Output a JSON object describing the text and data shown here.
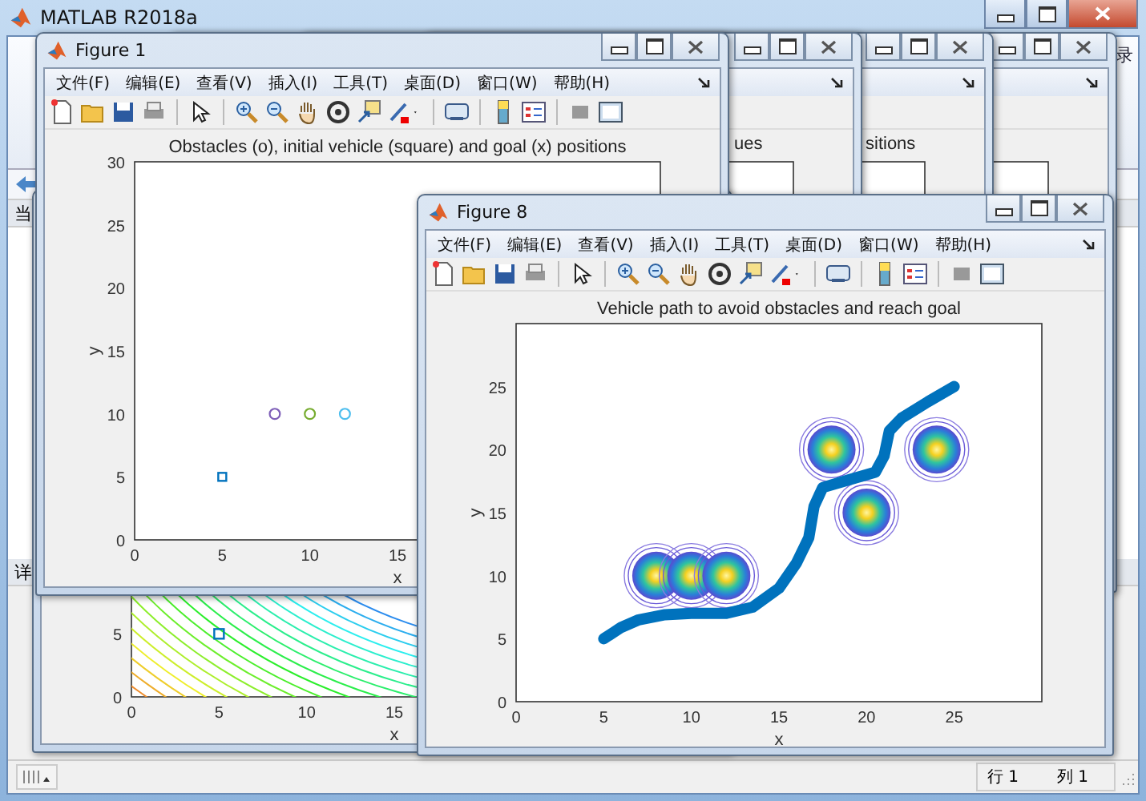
{
  "main_window": {
    "title": "MATLAB R2018a",
    "header_fragment": "录",
    "left_labels": [
      "当",
      "详"
    ],
    "status_bar": {
      "row": "行 1",
      "column": "列 1"
    }
  },
  "figures": [
    {
      "kind": "partial",
      "plot_title": "ues"
    },
    {
      "kind": "partial",
      "plot_title": "sitions"
    },
    {
      "kind": "partial"
    },
    {
      "kind": "contour",
      "picture": {
        "xticks": [
          "0",
          "5",
          "10",
          "15"
        ],
        "yticks": [
          "5",
          "0"
        ],
        "xlabel": "x"
      }
    },
    {
      "kind": "chart",
      "title": "Figure 1",
      "menu": [
        "文件(F)",
        "编辑(E)",
        "查看(V)",
        "插入(I)",
        "工具(T)",
        "桌面(D)",
        "窗口(W)",
        "帮助(H)"
      ],
      "chart_data": {
        "type": "scatter",
        "title": "Obstacles (o), initial vehicle (square) and goal (x) positions",
        "xlabel": "x",
        "ylabel": "y",
        "xlim": [
          0,
          30
        ],
        "ylim": [
          0,
          30
        ],
        "xticks": [
          0,
          5,
          10,
          15
        ],
        "yticks": [
          0,
          5,
          10,
          15,
          20,
          25,
          30
        ],
        "series": [
          {
            "color": "#0072bd",
            "x": [
              5
            ],
            "values": [
              5
            ]
          },
          {
            "color": "#7e5fb8",
            "x": [
              8
            ],
            "values": [
              10
            ]
          },
          {
            "color": "#77ac30",
            "x": [
              10
            ],
            "values": [
              10
            ]
          },
          {
            "color": "#4dbeee",
            "x": [
              12
            ],
            "values": [
              10
            ]
          }
        ]
      }
    },
    {
      "kind": "chart",
      "title": "Figure 8",
      "menu": [
        "文件(F)",
        "编辑(E)",
        "查看(V)",
        "插入(I)",
        "工具(T)",
        "桌面(D)",
        "窗口(W)",
        "帮助(H)"
      ],
      "chart_data": {
        "type": "line",
        "title": "Vehicle path to avoid obstacles and reach goal",
        "xlabel": "x",
        "ylabel": "y",
        "xlim": [
          0,
          30
        ],
        "ylim": [
          0,
          30
        ],
        "xticks": [
          0,
          5,
          10,
          15,
          20,
          25
        ],
        "yticks": [
          0,
          5,
          10,
          15,
          20,
          25
        ],
        "series": [
          {
            "color": "#0072bd",
            "x": [
              5,
              6,
              7,
              8.5,
              10,
              12,
              13.5,
              15,
              16,
              16.7,
              17,
              17.5,
              19,
              20.5,
              21,
              21.3,
              22,
              23.5,
              25
            ],
            "values": [
              5,
              5.9,
              6.5,
              6.9,
              7,
              7,
              7.5,
              9,
              11,
              13,
              15.5,
              17,
              17.6,
              18.2,
              19.5,
              21.5,
              22.5,
              23.8,
              25
            ]
          }
        ]
      }
    }
  ]
}
